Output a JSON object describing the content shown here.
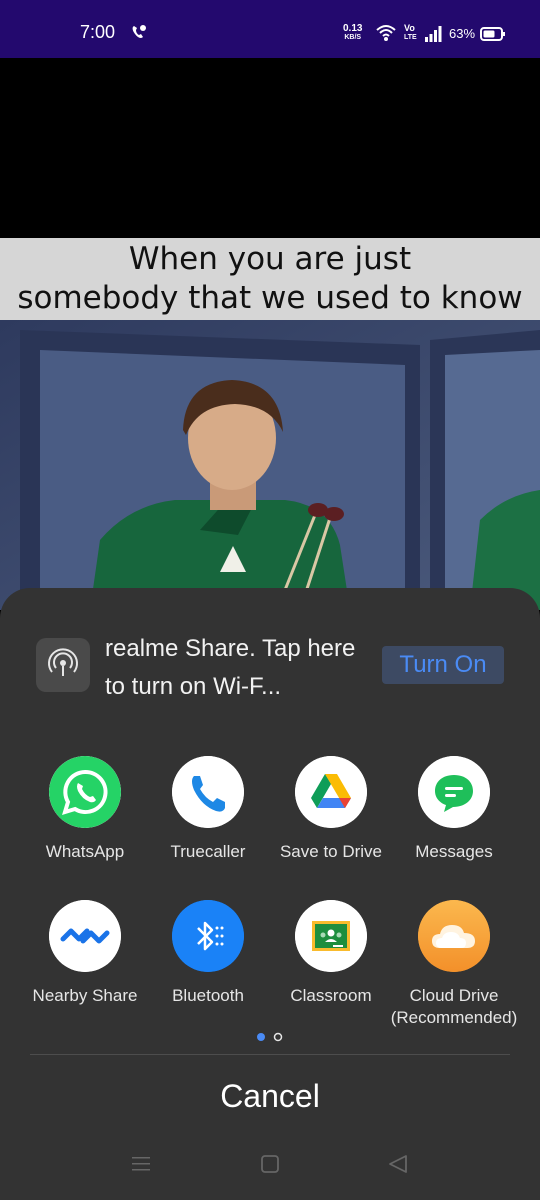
{
  "status_bar": {
    "time": "7:00",
    "speed_value": "0.13",
    "speed_unit": "KB/S",
    "volte_top": "Vo",
    "volte_bottom": "LTE",
    "battery": "63%"
  },
  "meme": {
    "caption_line1": "When you are just",
    "caption_line2": "somebody that we used to know"
  },
  "share_sheet": {
    "realme_share_text": "realme Share. Tap here to turn on Wi-F...",
    "turn_on_label": "Turn On",
    "apps": [
      {
        "label": "WhatsApp",
        "icon": "whatsapp-icon",
        "color": "#25d366"
      },
      {
        "label": "Truecaller",
        "icon": "truecaller-icon",
        "color": "#1e88e5"
      },
      {
        "label": "Save to Drive",
        "icon": "google-drive-icon",
        "color": "#ffffff"
      },
      {
        "label": "Messages",
        "icon": "messages-icon",
        "color": "#1fbf5a"
      },
      {
        "label": "Nearby Share",
        "icon": "nearby-share-icon",
        "color": "#1a73e8"
      },
      {
        "label": "Bluetooth",
        "icon": "bluetooth-icon",
        "color": "#1a82f7"
      },
      {
        "label": "Classroom",
        "icon": "classroom-icon",
        "color": "#1e8e3e"
      },
      {
        "label": "Cloud Drive (Recommended)",
        "icon": "cloud-drive-icon",
        "color": "#f9a33a"
      }
    ],
    "cancel_label": "Cancel"
  },
  "colors": {
    "status_bar_bg": "#23096e",
    "sheet_bg": "#333333",
    "accent": "#4a8bf5"
  }
}
